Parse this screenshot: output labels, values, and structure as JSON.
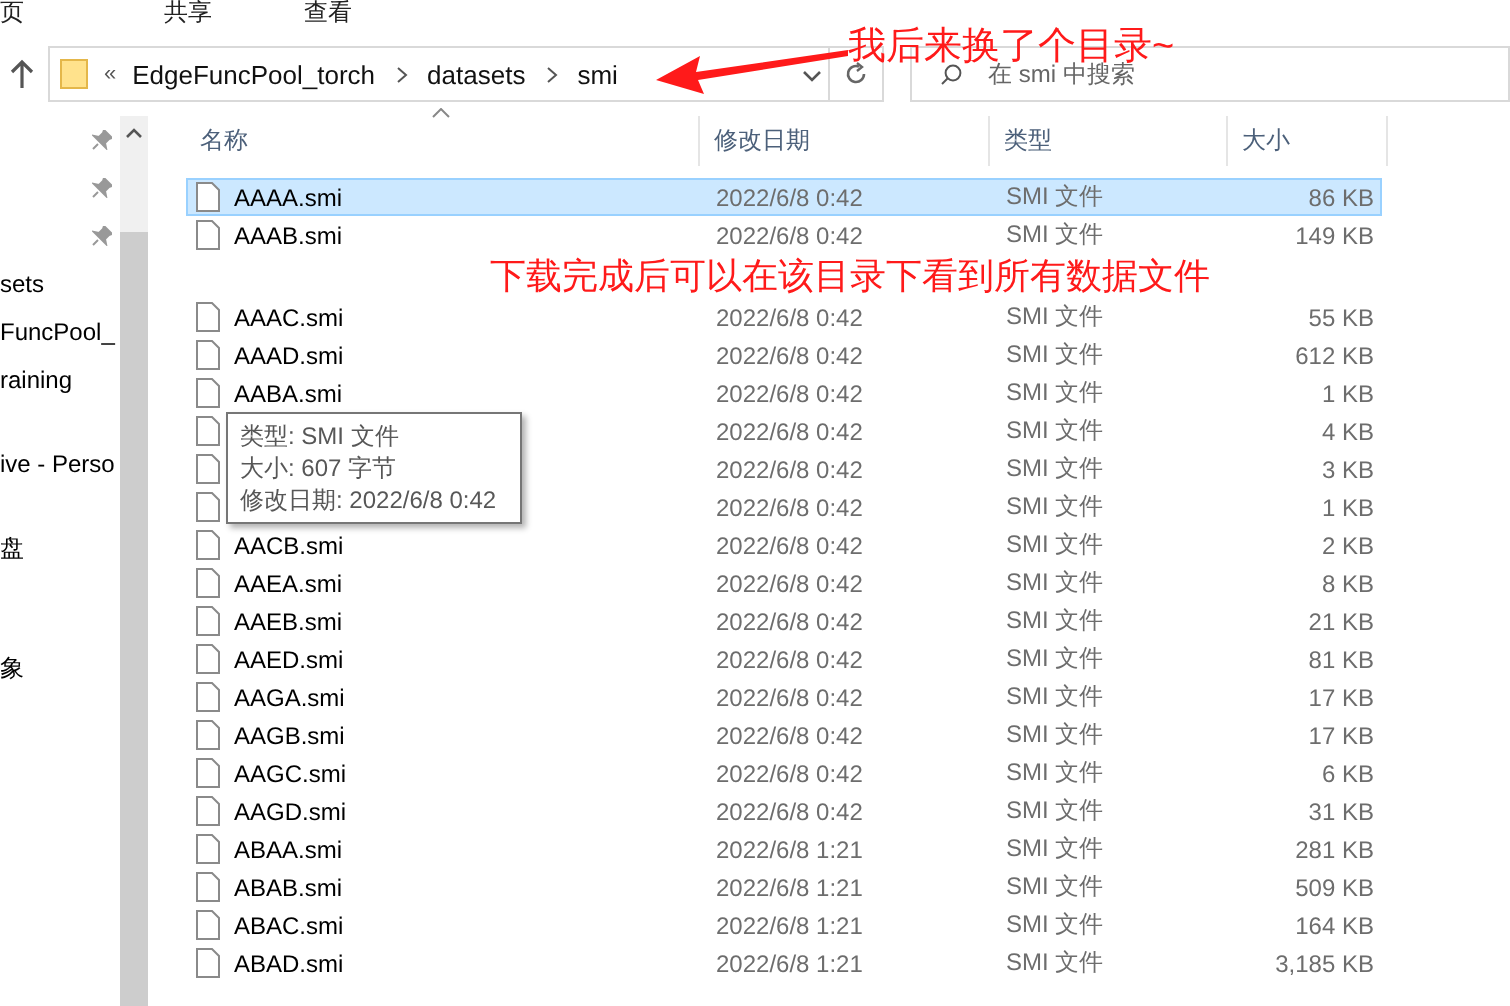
{
  "ribbon_tabs": [
    "页",
    "共享",
    "查看"
  ],
  "address_bar": {
    "overflow": "«",
    "path": [
      "EdgeFuncPool_torch",
      "datasets",
      "smi"
    ]
  },
  "search": {
    "placeholder": "在 smi 中搜索"
  },
  "nav_pane": {
    "items": [
      {
        "kind": "pin",
        "pinned": true
      },
      {
        "kind": "pin",
        "pinned": true
      },
      {
        "kind": "pin",
        "pinned": true
      },
      {
        "kind": "label",
        "label": "sets"
      },
      {
        "kind": "label",
        "label": "FuncPool_"
      },
      {
        "kind": "label",
        "label": "raining"
      },
      {
        "kind": "gap"
      },
      {
        "kind": "label",
        "label": "ive - Perso"
      },
      {
        "kind": "gap"
      },
      {
        "kind": "label",
        "label": "盘"
      },
      {
        "kind": "gap"
      },
      {
        "kind": "gap"
      },
      {
        "kind": "label",
        "label": "象"
      }
    ]
  },
  "columns": [
    "名称",
    "修改日期",
    "类型",
    "大小"
  ],
  "rows": [
    {
      "kind": "file",
      "name": "AAAA.smi",
      "date": "2022/6/8 0:42",
      "type": "SMI 文件",
      "size": "86 KB",
      "selected": true
    },
    {
      "kind": "file",
      "name": "AAAB.smi",
      "date": "2022/6/8 0:42",
      "type": "SMI 文件",
      "size": "149 KB",
      "selected": false
    },
    {
      "kind": "note",
      "text": "下载完成后可以在该目录下看到所有数据文件"
    },
    {
      "kind": "file",
      "name": "AAAC.smi",
      "date": "2022/6/8 0:42",
      "type": "SMI 文件",
      "size": "55 KB",
      "selected": false
    },
    {
      "kind": "file",
      "name": "AAAD.smi",
      "date": "2022/6/8 0:42",
      "type": "SMI 文件",
      "size": "612 KB",
      "selected": false
    },
    {
      "kind": "file",
      "name": "AABA.smi",
      "date": "2022/6/8 0:42",
      "type": "SMI 文件",
      "size": "1 KB",
      "selected": false
    },
    {
      "kind": "file",
      "date": "2022/6/8 0:42",
      "type": "SMI 文件",
      "size": "4 KB",
      "selected": false
    },
    {
      "kind": "file",
      "date": "2022/6/8 0:42",
      "type": "SMI 文件",
      "size": "3 KB",
      "selected": false
    },
    {
      "kind": "file",
      "date": "2022/6/8 0:42",
      "type": "SMI 文件",
      "size": "1 KB",
      "selected": false
    },
    {
      "kind": "file",
      "name": "AACB.smi",
      "date": "2022/6/8 0:42",
      "type": "SMI 文件",
      "size": "2 KB",
      "selected": false
    },
    {
      "kind": "file",
      "name": "AAEA.smi",
      "date": "2022/6/8 0:42",
      "type": "SMI 文件",
      "size": "8 KB",
      "selected": false
    },
    {
      "kind": "file",
      "name": "AAEB.smi",
      "date": "2022/6/8 0:42",
      "type": "SMI 文件",
      "size": "21 KB",
      "selected": false
    },
    {
      "kind": "file",
      "name": "AAED.smi",
      "date": "2022/6/8 0:42",
      "type": "SMI 文件",
      "size": "81 KB",
      "selected": false
    },
    {
      "kind": "file",
      "name": "AAGA.smi",
      "date": "2022/6/8 0:42",
      "type": "SMI 文件",
      "size": "17 KB",
      "selected": false
    },
    {
      "kind": "file",
      "name": "AAGB.smi",
      "date": "2022/6/8 0:42",
      "type": "SMI 文件",
      "size": "17 KB",
      "selected": false
    },
    {
      "kind": "file",
      "name": "AAGC.smi",
      "date": "2022/6/8 0:42",
      "type": "SMI 文件",
      "size": "6 KB",
      "selected": false
    },
    {
      "kind": "file",
      "name": "AAGD.smi",
      "date": "2022/6/8 0:42",
      "type": "SMI 文件",
      "size": "31 KB",
      "selected": false
    },
    {
      "kind": "file",
      "name": "ABAA.smi",
      "date": "2022/6/8 1:21",
      "type": "SMI 文件",
      "size": "281 KB",
      "selected": false
    },
    {
      "kind": "file",
      "name": "ABAB.smi",
      "date": "2022/6/8 1:21",
      "type": "SMI 文件",
      "size": "509 KB",
      "selected": false
    },
    {
      "kind": "file",
      "name": "ABAC.smi",
      "date": "2022/6/8 1:21",
      "type": "SMI 文件",
      "size": "164 KB",
      "selected": false
    },
    {
      "kind": "file",
      "name": "ABAD.smi",
      "date": "2022/6/8 1:21",
      "type": "SMI 文件",
      "size": "3,185 KB",
      "selected": false
    }
  ],
  "tooltip": {
    "lines": [
      "类型: SMI 文件",
      "大小: 607 字节",
      "修改日期: 2022/6/8 0:42"
    ]
  },
  "annotations": [
    {
      "kind": "arrow-note",
      "text": "我后来换了个目录~"
    }
  ]
}
